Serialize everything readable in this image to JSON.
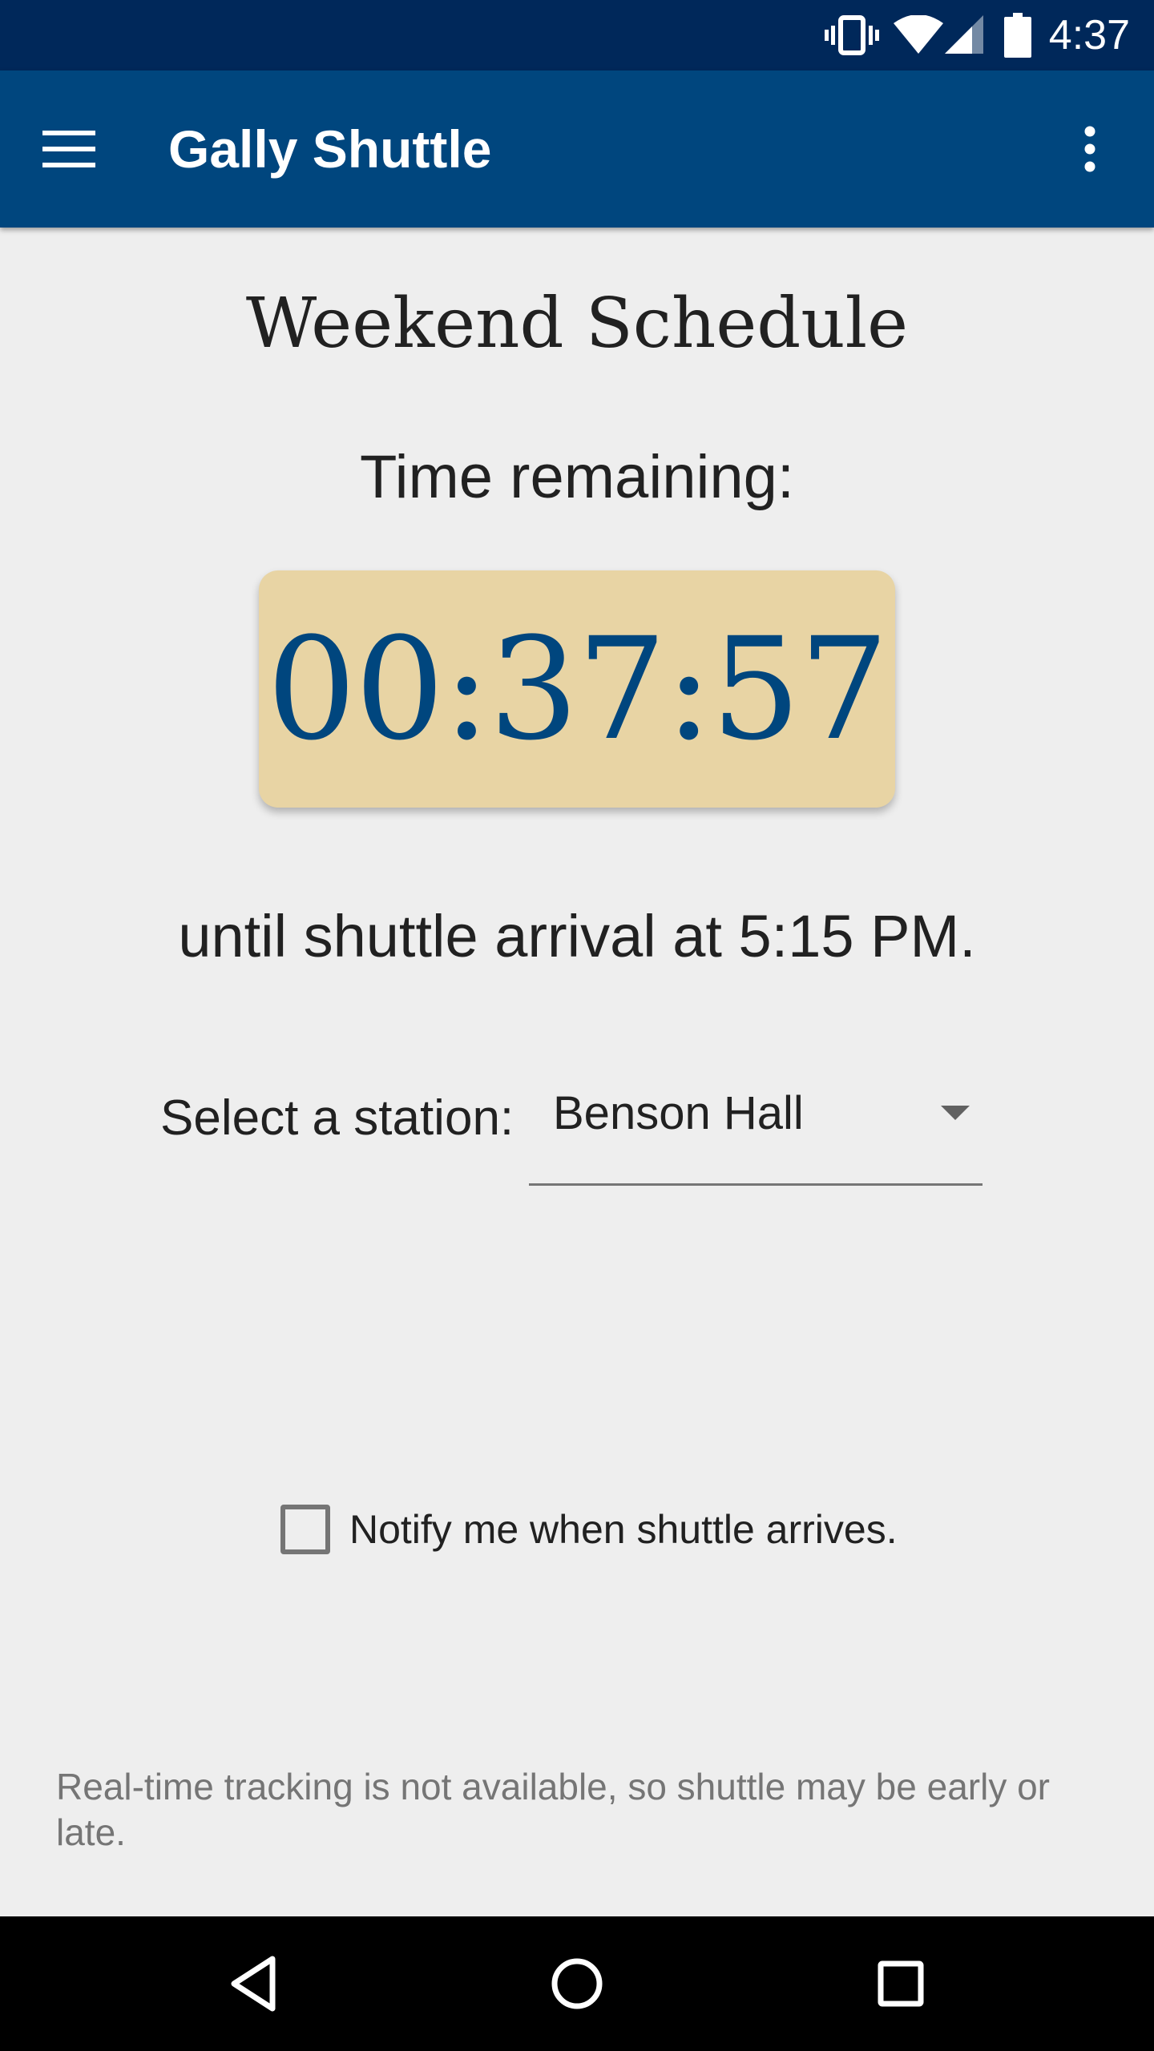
{
  "status_bar": {
    "time": "4:37",
    "icons": [
      "vibrate-icon",
      "wifi-icon",
      "signal-icon",
      "battery-icon"
    ]
  },
  "app_bar": {
    "title": "Gally Shuttle",
    "menu_icon": "hamburger-menu-icon",
    "overflow_icon": "more-vert-icon"
  },
  "main": {
    "schedule_title": "Weekend Schedule",
    "remaining_label": "Time remaining:",
    "countdown": "00:37:57",
    "arrival_text": "until shuttle arrival at 5:15 PM.",
    "station_label": "Select a station:",
    "station_selected": "Benson Hall",
    "notify_label": "Notify me when shuttle arrives.",
    "notify_checked": false,
    "disclaimer": "Real-time tracking is not available, so shuttle may be early or late."
  },
  "nav_bar": {
    "icons": [
      "back-icon",
      "home-icon",
      "recents-icon"
    ]
  },
  "colors": {
    "status_bar": "#00285a",
    "app_bar": "#00467e",
    "timer_background": "#e8d4a4",
    "timer_text": "#00467e",
    "background": "#eeeeee"
  }
}
